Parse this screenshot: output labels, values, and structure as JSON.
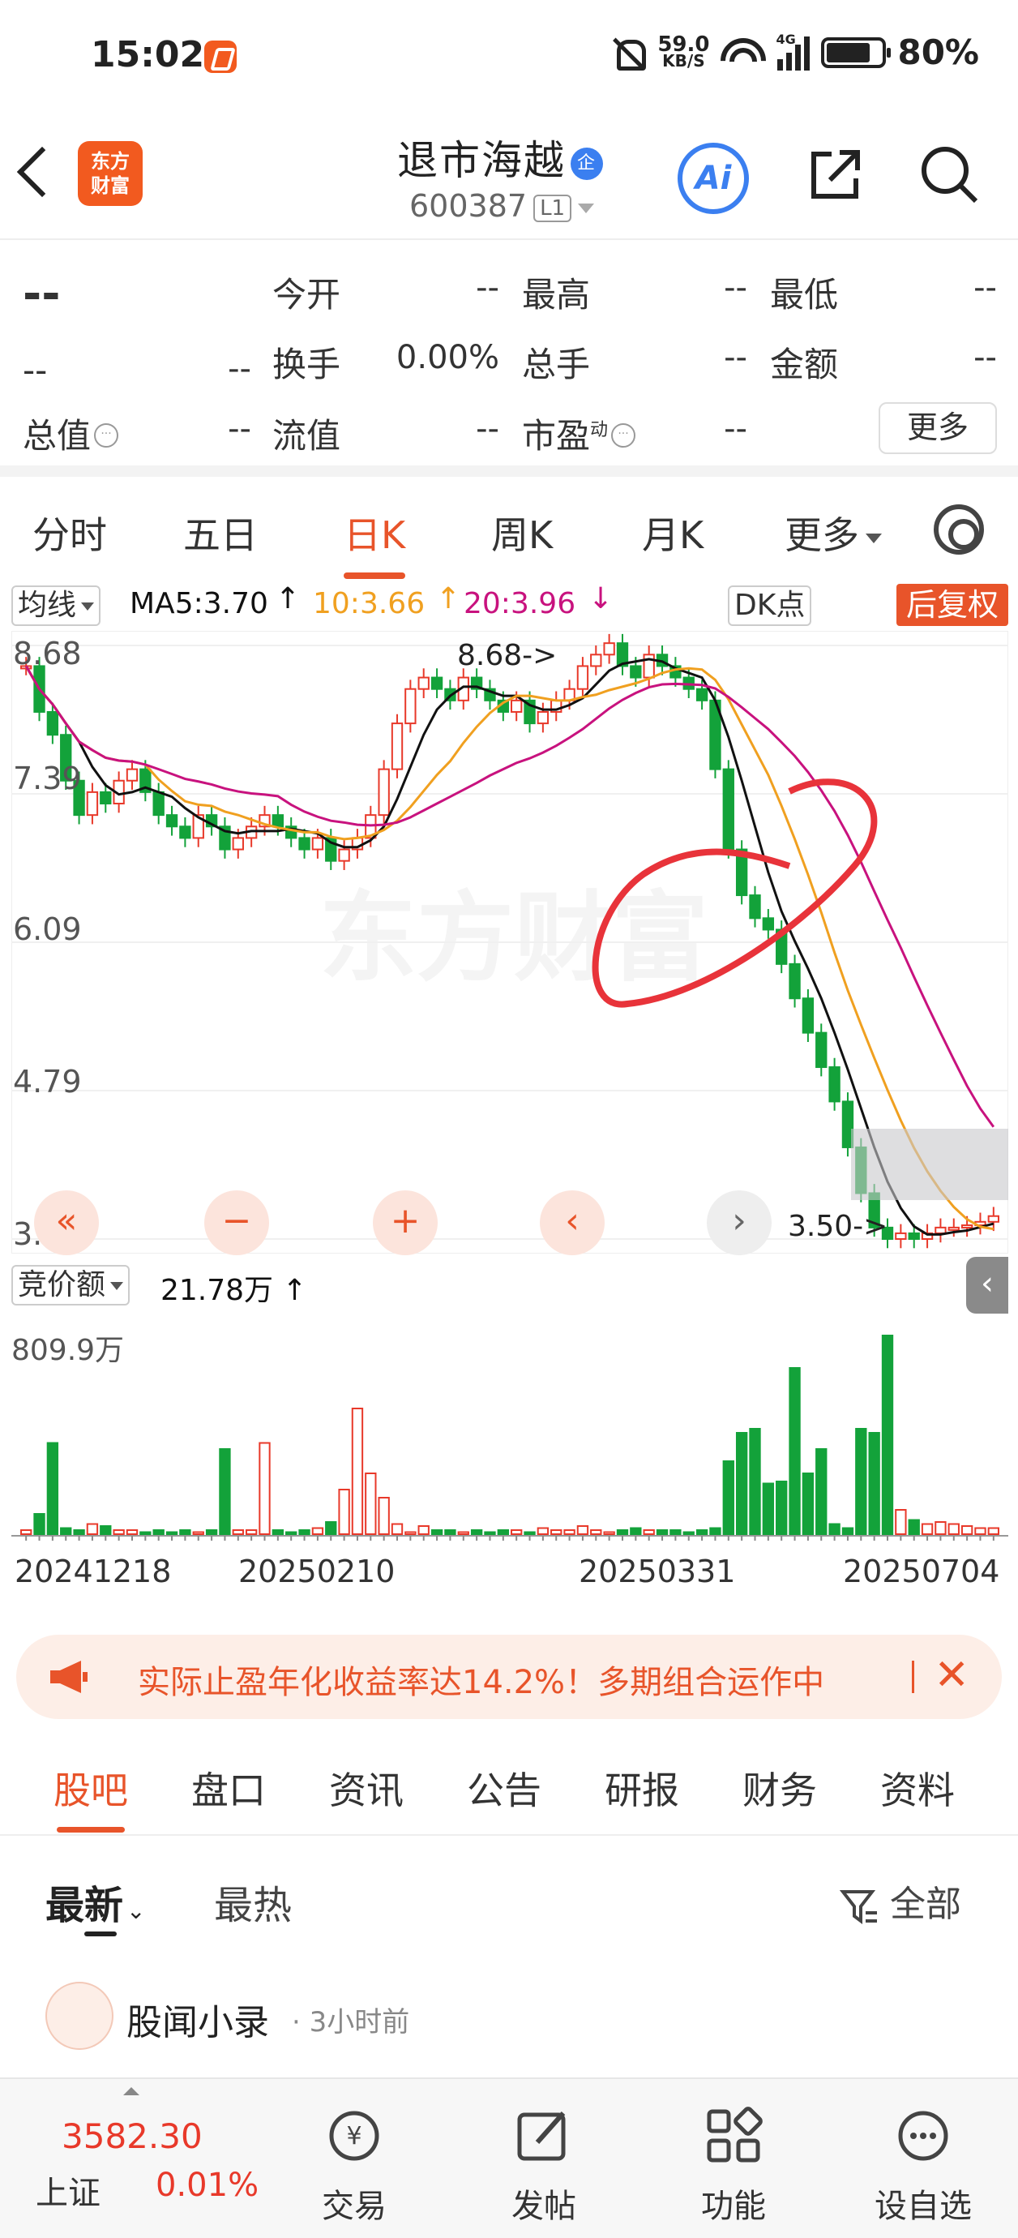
{
  "status": {
    "time": "15:02",
    "net_speed": "59.0",
    "net_unit": "KB/S",
    "network": "4G",
    "battery": "80%"
  },
  "header": {
    "title": "退市海越",
    "ent_badge": "企",
    "code": "600387",
    "level": "L1",
    "ai_label": "Ai",
    "logo_top": "东方",
    "logo_bottom": "财富"
  },
  "quote": {
    "price": "--",
    "change": "--",
    "change_pct": "--",
    "fields": [
      {
        "label": "今开",
        "value": "--"
      },
      {
        "label": "最高",
        "value": "--"
      },
      {
        "label": "最低",
        "value": "--"
      },
      {
        "label": "换手",
        "value": "0.00%"
      },
      {
        "label": "总手",
        "value": "--"
      },
      {
        "label": "金额",
        "value": "--"
      },
      {
        "label": "总值",
        "value": "--"
      },
      {
        "label": "流值",
        "value": "--"
      },
      {
        "label": "市盈",
        "value": "--",
        "sup": "动"
      }
    ],
    "more_label": "更多"
  },
  "period_tabs": [
    "分时",
    "五日",
    "日K",
    "周K",
    "月K",
    "更多"
  ],
  "active_period": "日K",
  "ma": {
    "select": "均线",
    "ma5": "MA5:3.70",
    "ma10": "10:3.66",
    "ma20": "20:3.96",
    "dk": "DK点",
    "adjust": "后复权"
  },
  "chart_data": {
    "type": "candlestick",
    "y_ticks": [
      "8.68",
      "7.39",
      "6.09",
      "4.79",
      "3.50"
    ],
    "ylim": [
      3.5,
      8.68
    ],
    "high_marker": "8.68->",
    "low_marker": "3.50->",
    "ma_colors": {
      "ma5": "#111111",
      "ma10": "#f0a020",
      "ma20": "#c8127e"
    },
    "closes": [
      8.5,
      8.1,
      7.9,
      7.5,
      7.2,
      7.4,
      7.3,
      7.5,
      7.6,
      7.4,
      7.2,
      7.1,
      7.0,
      7.2,
      7.1,
      6.9,
      7.0,
      7.1,
      7.2,
      7.1,
      7.0,
      6.9,
      7.0,
      6.8,
      6.9,
      7.0,
      7.2,
      7.6,
      8.0,
      8.3,
      8.4,
      8.3,
      8.2,
      8.4,
      8.3,
      8.2,
      8.1,
      8.2,
      8.0,
      8.1,
      8.2,
      8.3,
      8.5,
      8.6,
      8.7,
      8.5,
      8.4,
      8.6,
      8.5,
      8.4,
      8.3,
      8.2,
      7.6,
      6.9,
      6.5,
      6.3,
      6.2,
      5.9,
      5.6,
      5.3,
      5.0,
      4.7,
      4.3,
      3.9,
      3.6,
      3.5,
      3.55,
      3.5,
      3.55,
      3.6,
      3.6,
      3.62,
      3.65,
      3.7
    ]
  },
  "controls": [
    "«",
    "−",
    "+",
    "‹",
    "›"
  ],
  "volume": {
    "select": "竞价额",
    "value": "21.78万",
    "max_label": "809.9万",
    "bars": [
      0.02,
      0.1,
      0.45,
      0.03,
      0.02,
      0.05,
      0.04,
      0.02,
      0.02,
      0.01,
      0.02,
      0.01,
      0.02,
      0.01,
      0.02,
      0.42,
      0.02,
      0.02,
      0.45,
      0.02,
      0.01,
      0.02,
      0.03,
      0.06,
      0.22,
      0.62,
      0.3,
      0.18,
      0.05,
      0.01,
      0.04,
      0.02,
      0.02,
      0.01,
      0.02,
      0.01,
      0.02,
      0.02,
      0.01,
      0.03,
      0.02,
      0.02,
      0.04,
      0.02,
      0.01,
      0.02,
      0.03,
      0.02,
      0.02,
      0.02,
      0.01,
      0.02,
      0.03,
      0.36,
      0.5,
      0.52,
      0.25,
      0.26,
      0.82,
      0.3,
      0.42,
      0.05,
      0.03,
      0.52,
      0.5,
      0.98,
      0.12,
      0.07,
      0.05,
      0.06,
      0.05,
      0.04,
      0.03,
      0.03
    ]
  },
  "dates": [
    "20241218",
    "20250210",
    "20250331",
    "20250704"
  ],
  "banner": {
    "text": "实际止盈年化收益率达14.2%！多期组合运作中"
  },
  "section_tabs": [
    "股吧",
    "盘口",
    "资讯",
    "公告",
    "研报",
    "财务",
    "资料"
  ],
  "sort": {
    "latest": "最新",
    "hot": "最热",
    "filter": "全部"
  },
  "post": {
    "author": "股闻小录",
    "time": "· 3小时前"
  },
  "bottom_nav": {
    "index_value": "3582.30",
    "index_name": "上证",
    "index_pct": "0.01%",
    "items": [
      "交易",
      "发帖",
      "功能",
      "设自选"
    ]
  }
}
